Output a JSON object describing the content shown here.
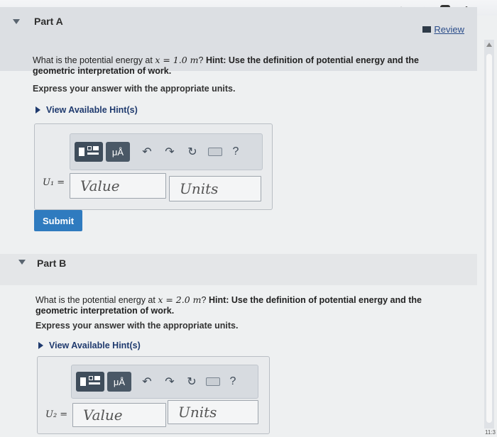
{
  "browser": {
    "share_icon": "share-icon",
    "star_icon": "bookmark-star-icon",
    "shield_icon": "shield-extension-icon",
    "puzzle_icon": "puzzle-extension-icon"
  },
  "review_label": "Review",
  "part_a": {
    "title": "Part A",
    "question_prefix": "What is the potential energy at ",
    "question_math": "x = 1.0 m",
    "question_mark": "?",
    "hint_text": " Hint: Use the definition of potential energy and the geometric interpretation of work.",
    "instruction": "Express your answer with the appropriate units.",
    "hints_label": "View Available Hint(s)",
    "variable_label": "U₁ =",
    "value_placeholder": "Value",
    "units_placeholder": "Units",
    "submit_label": "Submit"
  },
  "part_b": {
    "title": "Part B",
    "question_prefix": "What is the potential energy at ",
    "question_math": "x = 2.0 m",
    "question_mark": "?",
    "hint_text": " Hint: Use the definition of potential energy and the geometric interpretation of work.",
    "instruction": "Express your answer with the appropriate units.",
    "hints_label": "View Available Hint(s)",
    "variable_label": "U₂ =",
    "value_placeholder": "Value",
    "units_placeholder": "Units"
  },
  "toolbar": {
    "mu_label": "μÅ",
    "help_label": "?"
  },
  "clock_text": "11:3"
}
